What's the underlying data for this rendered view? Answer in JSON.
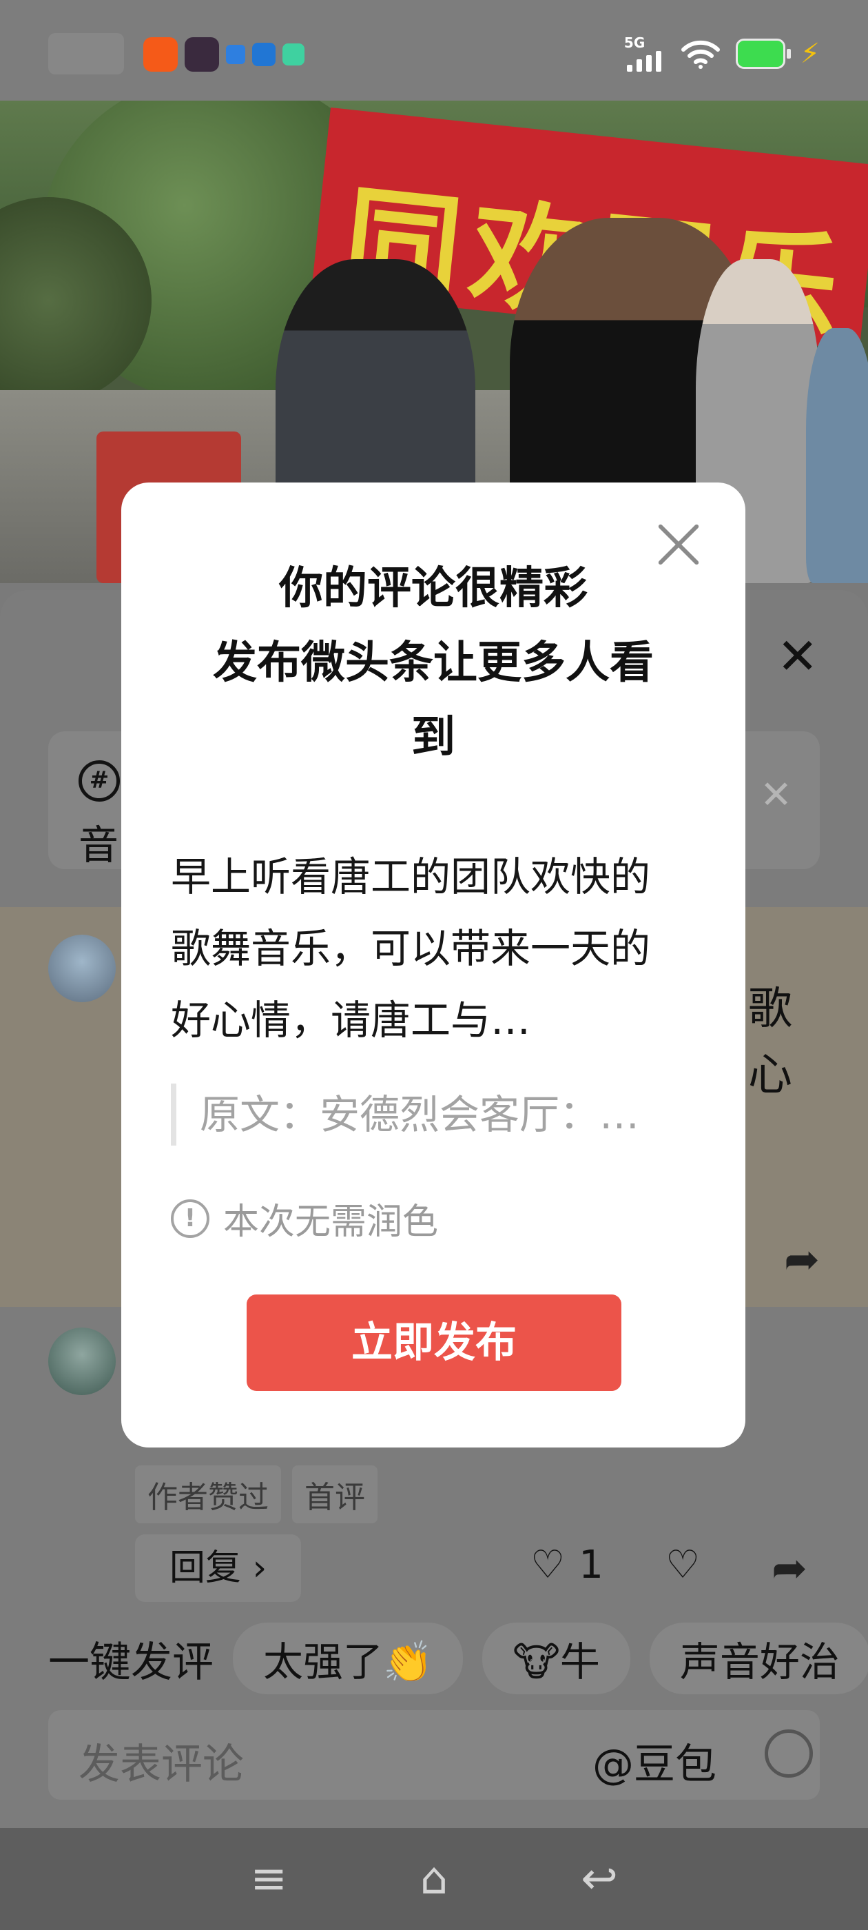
{
  "status_bar": {
    "network": "5G",
    "app_icon_colors": [
      "#f55a18",
      "#3a2a3e",
      "#2e7fe0",
      "#2176d4",
      "#3fd1a0"
    ],
    "battery_color": "#3ddc4f"
  },
  "video": {
    "banner_text": "同欢同乐"
  },
  "comment_sheet": {
    "topic_icon": "#",
    "topic_text": "音",
    "highlighted_comment_fragment_1": "歌",
    "highlighted_comment_fragment_2": "心",
    "second_comment": {
      "tags": [
        "作者赞过",
        "首评"
      ],
      "reply_label": "回复 ›",
      "like_count": "1"
    },
    "quick_comment": {
      "title": "一键发评",
      "chips": [
        "太强了👏",
        "🐮牛",
        "声音好治"
      ]
    },
    "input": {
      "placeholder": "发表评论",
      "at_label": "@豆包"
    }
  },
  "modal": {
    "title_line1": "你的评论很精彩",
    "title_line2": "发布微头条让更多人看",
    "title_line3": "到",
    "body": "早上听看唐工的团队欢快的歌舞音乐，可以带来一天的好心情，请唐工与…",
    "quote": "原文：安德烈会客厅：…",
    "note": "本次无需润色",
    "publish_label": "立即发布",
    "accent_color": "#ec544a"
  }
}
